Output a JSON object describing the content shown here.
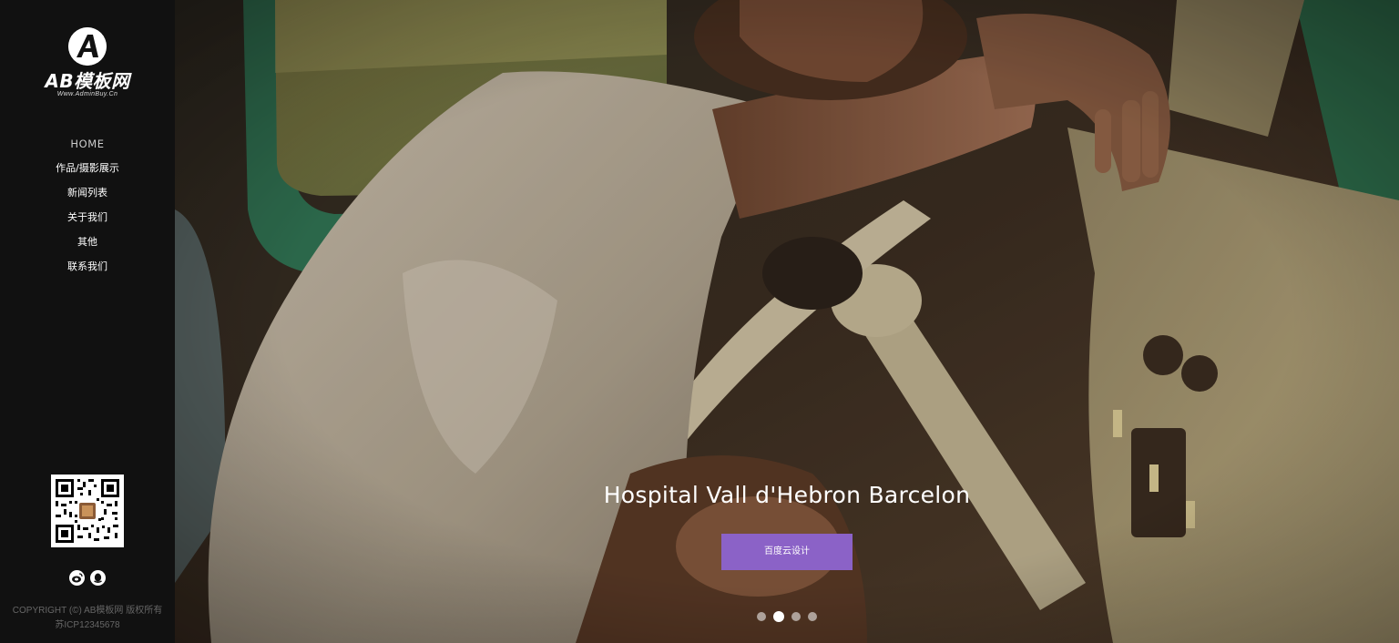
{
  "brand": {
    "name": "AB模板网",
    "url_text": "Www.AdminBuy.Cn"
  },
  "nav": {
    "items": [
      {
        "label": "HOME"
      },
      {
        "label": "作品/摄影展示"
      },
      {
        "label": "新闻列表"
      },
      {
        "label": "关于我们"
      },
      {
        "label": "其他"
      },
      {
        "label": "联系我们"
      }
    ]
  },
  "social": {
    "icons": [
      "weibo-icon",
      "qq-icon"
    ]
  },
  "footer": {
    "copyright": "COPYRIGHT (©) AB模板网 版权所有",
    "icp": "苏ICP12345678"
  },
  "hero": {
    "caption": "Hospital Vall d'Hebron Barcelon",
    "button_label": "百度云设计",
    "slides_total": 4,
    "active_slide": 2
  },
  "colors": {
    "sidebar_bg": "#111111",
    "accent": "#8b62c7"
  }
}
